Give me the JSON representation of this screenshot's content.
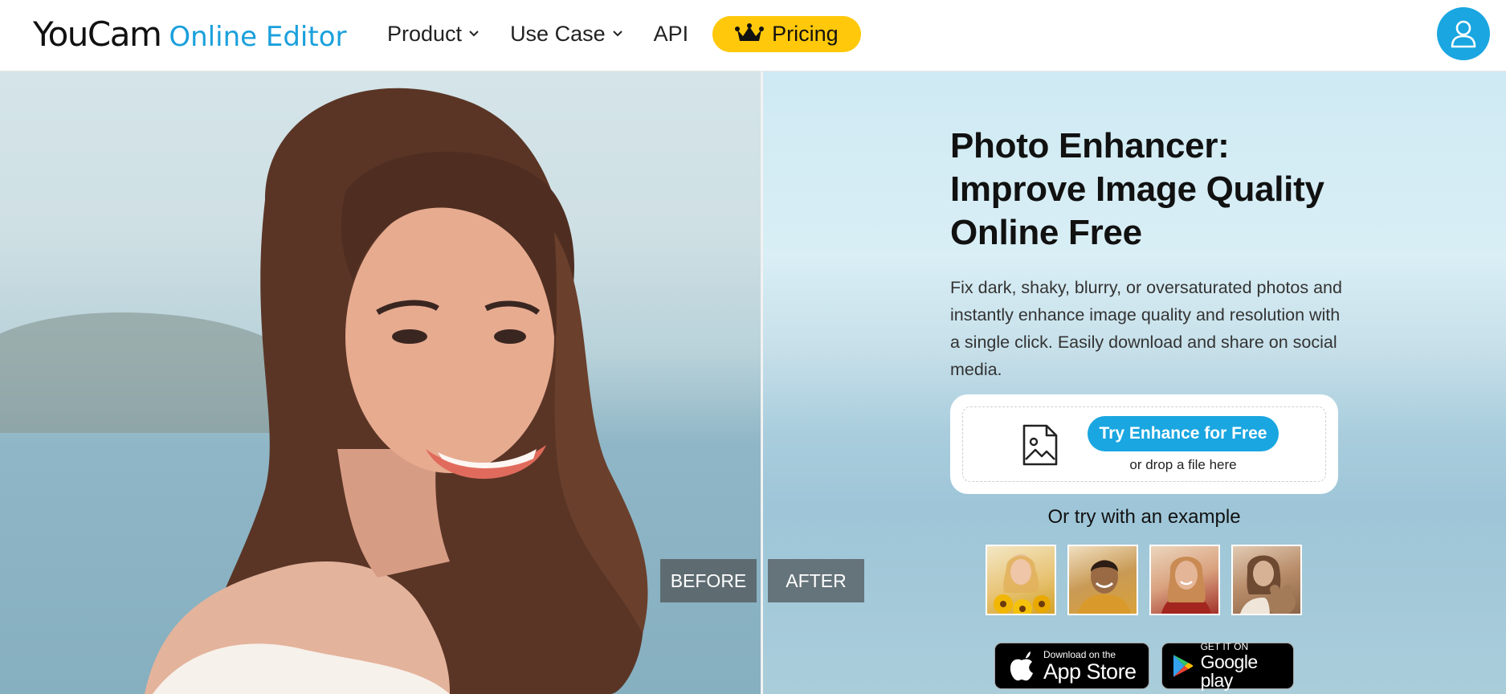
{
  "header": {
    "logo_main": "YouCam",
    "logo_sub": "Online Editor",
    "nav": [
      {
        "label": "Product",
        "has_dropdown": true
      },
      {
        "label": "Use Case",
        "has_dropdown": true
      },
      {
        "label": "API",
        "has_dropdown": false
      }
    ],
    "pricing_label": "Pricing",
    "pricing_icon": "crown-icon",
    "account_icon": "user-icon"
  },
  "hero": {
    "title_line1": "Photo Enhancer:",
    "title_line2": "Improve Image Quality",
    "title_line3": "Online Free",
    "description": "Fix dark, shaky, blurry, or oversaturated photos and instantly enhance image quality and resolution with a single click. Easily download and share on social media.",
    "before_label": "BEFORE",
    "after_label": "AFTER"
  },
  "upload": {
    "icon": "image-file-icon",
    "button_label": "Try Enhance for Free",
    "drop_text": "or drop a file here"
  },
  "examples": {
    "label": "Or try with an example",
    "items": [
      "example-1",
      "example-2",
      "example-3",
      "example-4"
    ]
  },
  "stores": {
    "appstore_small": "Download on the",
    "appstore_big": "App Store",
    "google_small": "GET IT ON",
    "google_big": "Google play"
  },
  "colors": {
    "brand_blue": "#1aa6e0",
    "pricing_yellow": "#ffc80a"
  }
}
